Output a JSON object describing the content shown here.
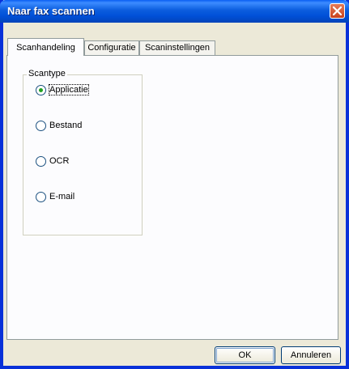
{
  "window": {
    "title": "Naar fax scannen"
  },
  "tabs": [
    {
      "label": "Scanhandeling"
    },
    {
      "label": "Configuratie"
    },
    {
      "label": "Scaninstellingen"
    }
  ],
  "scantype": {
    "legend": "Scantype",
    "options": [
      {
        "label": "Applicatie",
        "selected": true
      },
      {
        "label": "Bestand",
        "selected": false
      },
      {
        "label": "OCR",
        "selected": false
      },
      {
        "label": "E-mail",
        "selected": false
      }
    ]
  },
  "buttons": {
    "ok": "OK",
    "cancel": "Annuleren"
  },
  "colors": {
    "titlebar": "#0058e6",
    "close": "#c8421d",
    "face": "#ece9d8",
    "radio_dot": "#21a121"
  }
}
